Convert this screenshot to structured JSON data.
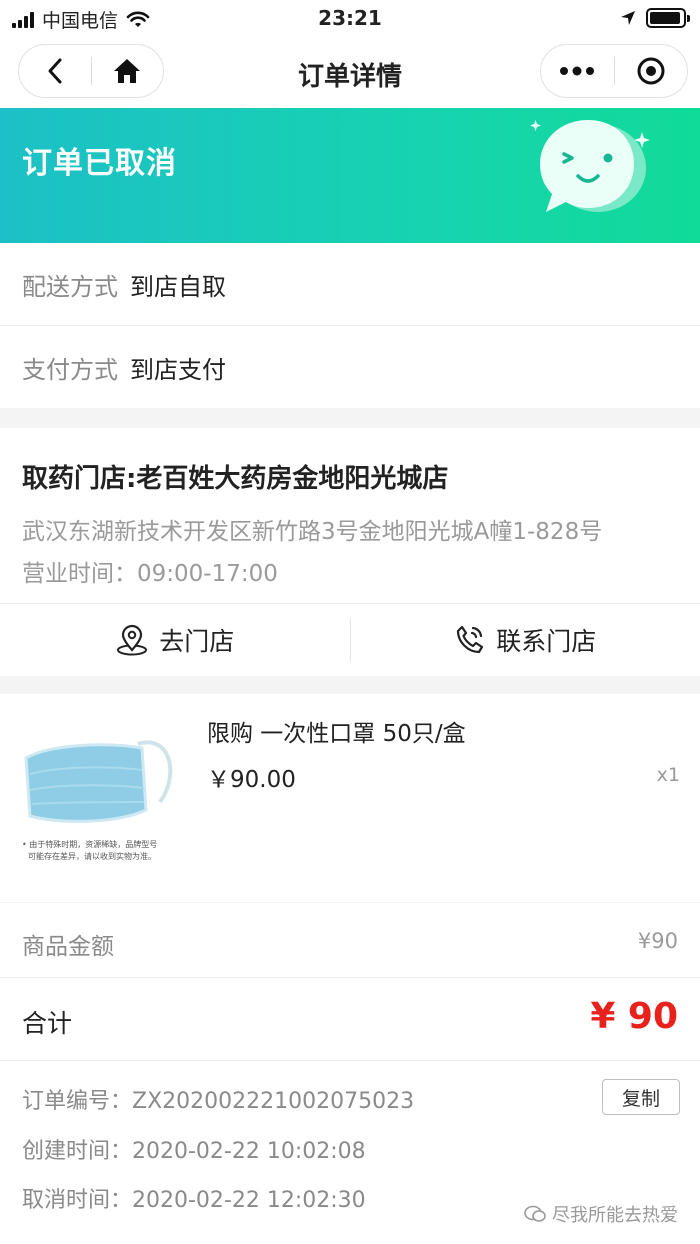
{
  "status_bar": {
    "carrier": "中国电信",
    "time": "23:21"
  },
  "nav": {
    "title": "订单详情"
  },
  "banner": {
    "title": "订单已取消"
  },
  "delivery": {
    "label": "配送方式",
    "value": "到店自取"
  },
  "payment": {
    "label": "支付方式",
    "value": "到店支付"
  },
  "store": {
    "name": "取药门店:老百姓大药房金地阳光城店",
    "address": "武汉东湖新技术开发区新竹路3号金地阳光城A幢1-828号",
    "hours": "营业时间：09:00-17:00",
    "go_label": "去门店",
    "contact_label": "联系门店"
  },
  "product": {
    "title": "限购 一次性口罩 50只/盒",
    "price": "￥90.00",
    "qty": "x1",
    "image_note_line1": "• 由于特殊时期，资源稀缺，品牌型号",
    "image_note_line2": "可能存在差异，请以收到实物为准。"
  },
  "amount": {
    "label": "商品金额",
    "value": "¥90"
  },
  "total": {
    "label": "合计",
    "value": "¥ 90"
  },
  "order_info": {
    "number": "订单编号：ZX20200222100207502​3",
    "created": "创建时间：2020-02-22 10:02:08",
    "cancelled": "取消时间：2020-02-22 12:02:30",
    "copy_label": "复制"
  },
  "watermark": {
    "text": "尽我所能去热爱"
  },
  "colors": {
    "accent_start": "#1cc0c6",
    "accent_end": "#10db98",
    "price_red": "#e8211d"
  }
}
